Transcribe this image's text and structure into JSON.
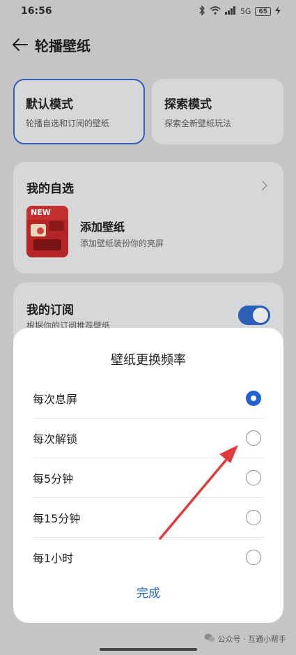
{
  "status_bar": {
    "time": "16:56",
    "network_label": "5G",
    "battery": "65"
  },
  "header": {
    "back_icon": "arrow-left-icon",
    "title": "轮播壁纸"
  },
  "modes": [
    {
      "title": "默认模式",
      "subtitle": "轮播自选和订阅的壁纸",
      "selected": true
    },
    {
      "title": "探索模式",
      "subtitle": "探索全新壁纸玩法",
      "selected": false
    }
  ],
  "my_picks": {
    "title": "我的自选",
    "thumb_badge": "NEW",
    "add_title": "添加壁纸",
    "add_subtitle": "添加壁纸装扮你的亮屏"
  },
  "subscription": {
    "title": "我的订阅",
    "subtitle": "根据你的订阅推荐壁纸",
    "toggle_on": true
  },
  "sheet": {
    "title": "壁纸更换频率",
    "options": [
      {
        "label": "每次息屏",
        "checked": true
      },
      {
        "label": "每次解锁",
        "checked": false
      },
      {
        "label": "每5分钟",
        "checked": false
      },
      {
        "label": "每15分钟",
        "checked": false
      },
      {
        "label": "每1小时",
        "checked": false
      }
    ],
    "done_label": "完成"
  },
  "watermark": "公众号 · 互通小帮手",
  "colors": {
    "accent": "#2461d0",
    "arrow": "#e03a3a"
  }
}
